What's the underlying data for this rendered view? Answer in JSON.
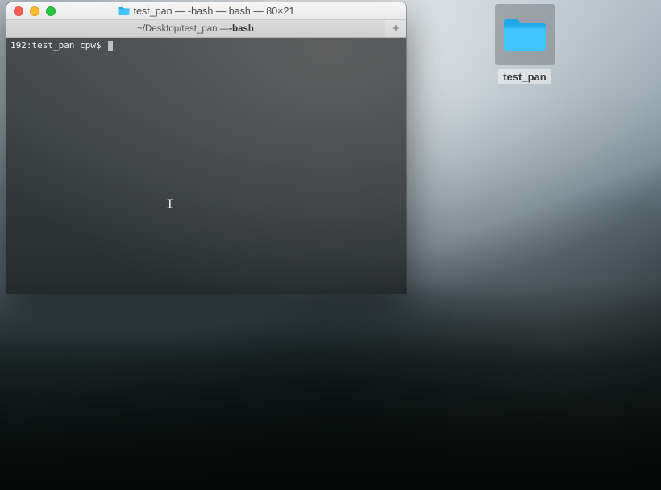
{
  "desktop": {
    "folder_label": "test_pan"
  },
  "window": {
    "title": "test_pan — -bash — bash — 80×21",
    "tab": {
      "path": "~/Desktop/test_pan — ",
      "process": "-bash"
    },
    "new_tab_glyph": "+"
  },
  "terminal": {
    "prompt": "192:test_pan cpw$ "
  },
  "cursor_glyph": "I"
}
